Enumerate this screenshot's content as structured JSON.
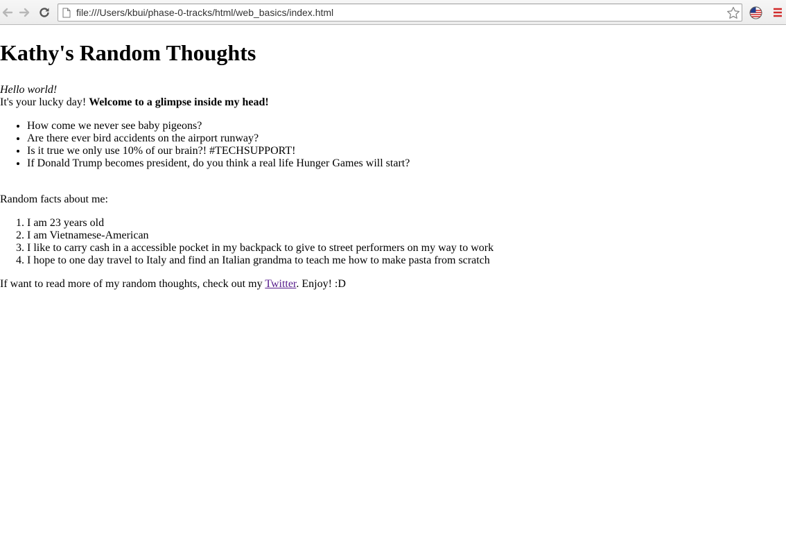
{
  "browser": {
    "url": "file:///Users/kbui/phase-0-tracks/html/web_basics/index.html",
    "icons": {
      "back": "back-arrow-icon",
      "forward": "forward-arrow-icon",
      "reload": "reload-icon",
      "page": "page-icon",
      "bookmark": "star-icon",
      "extension": "flag-globe-icon",
      "menu": "hamburger-menu-icon"
    }
  },
  "page": {
    "title": "Kathy's Random Thoughts",
    "greeting": "Hello world!",
    "intro_plain": "It's your lucky day! ",
    "intro_bold": "Welcome to a glimpse inside my head!",
    "thoughts": [
      "How come we never see baby pigeons?",
      "Are there ever bird accidents on the airport runway?",
      "Is it true we only use 10% of our brain?! #TECHSUPPORT!",
      "If Donald Trump becomes president, do you think a real life Hunger Games will start?"
    ],
    "facts_heading": "Random facts about me:",
    "facts": [
      "I am 23 years old",
      "I am Vietnamese-American",
      "I like to carry cash in a accessible pocket in my backpack to give to street performers on my way to work",
      "I hope to one day travel to Italy and find an Italian grandma to teach me how to make pasta from scratch"
    ],
    "outro_before": "If want to read more of my random thoughts, check out my ",
    "outro_link": "Twitter",
    "outro_after": ". Enjoy! :D",
    "link_color": "#551a8b"
  }
}
